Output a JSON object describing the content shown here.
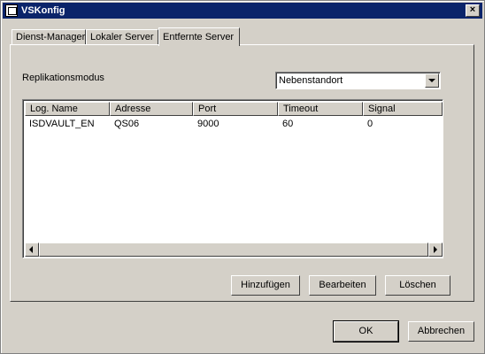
{
  "window": {
    "title": "VSKonfig",
    "close_label": "×"
  },
  "tabs": [
    {
      "label": "Dienst-Manager"
    },
    {
      "label": "Lokaler Server"
    },
    {
      "label": "Entfernte Server",
      "active": true
    }
  ],
  "replication": {
    "label": "Replikationsmodus",
    "selected": "Nebenstandort"
  },
  "table": {
    "columns": [
      "Log. Name",
      "Adresse",
      "Port",
      "Timeout",
      "Signal"
    ],
    "rows": [
      [
        "ISDVAULT_EN",
        "QS06",
        "9000",
        "60",
        "0"
      ]
    ]
  },
  "actions": {
    "add": "Hinzufügen",
    "edit": "Bearbeiten",
    "delete": "Löschen"
  },
  "footer": {
    "ok": "OK",
    "cancel": "Abbrechen"
  },
  "icons": {
    "title": "app-icon",
    "dropdown": "chevron-down-icon",
    "scroll_left": "arrow-left-icon",
    "scroll_right": "arrow-right-icon"
  }
}
